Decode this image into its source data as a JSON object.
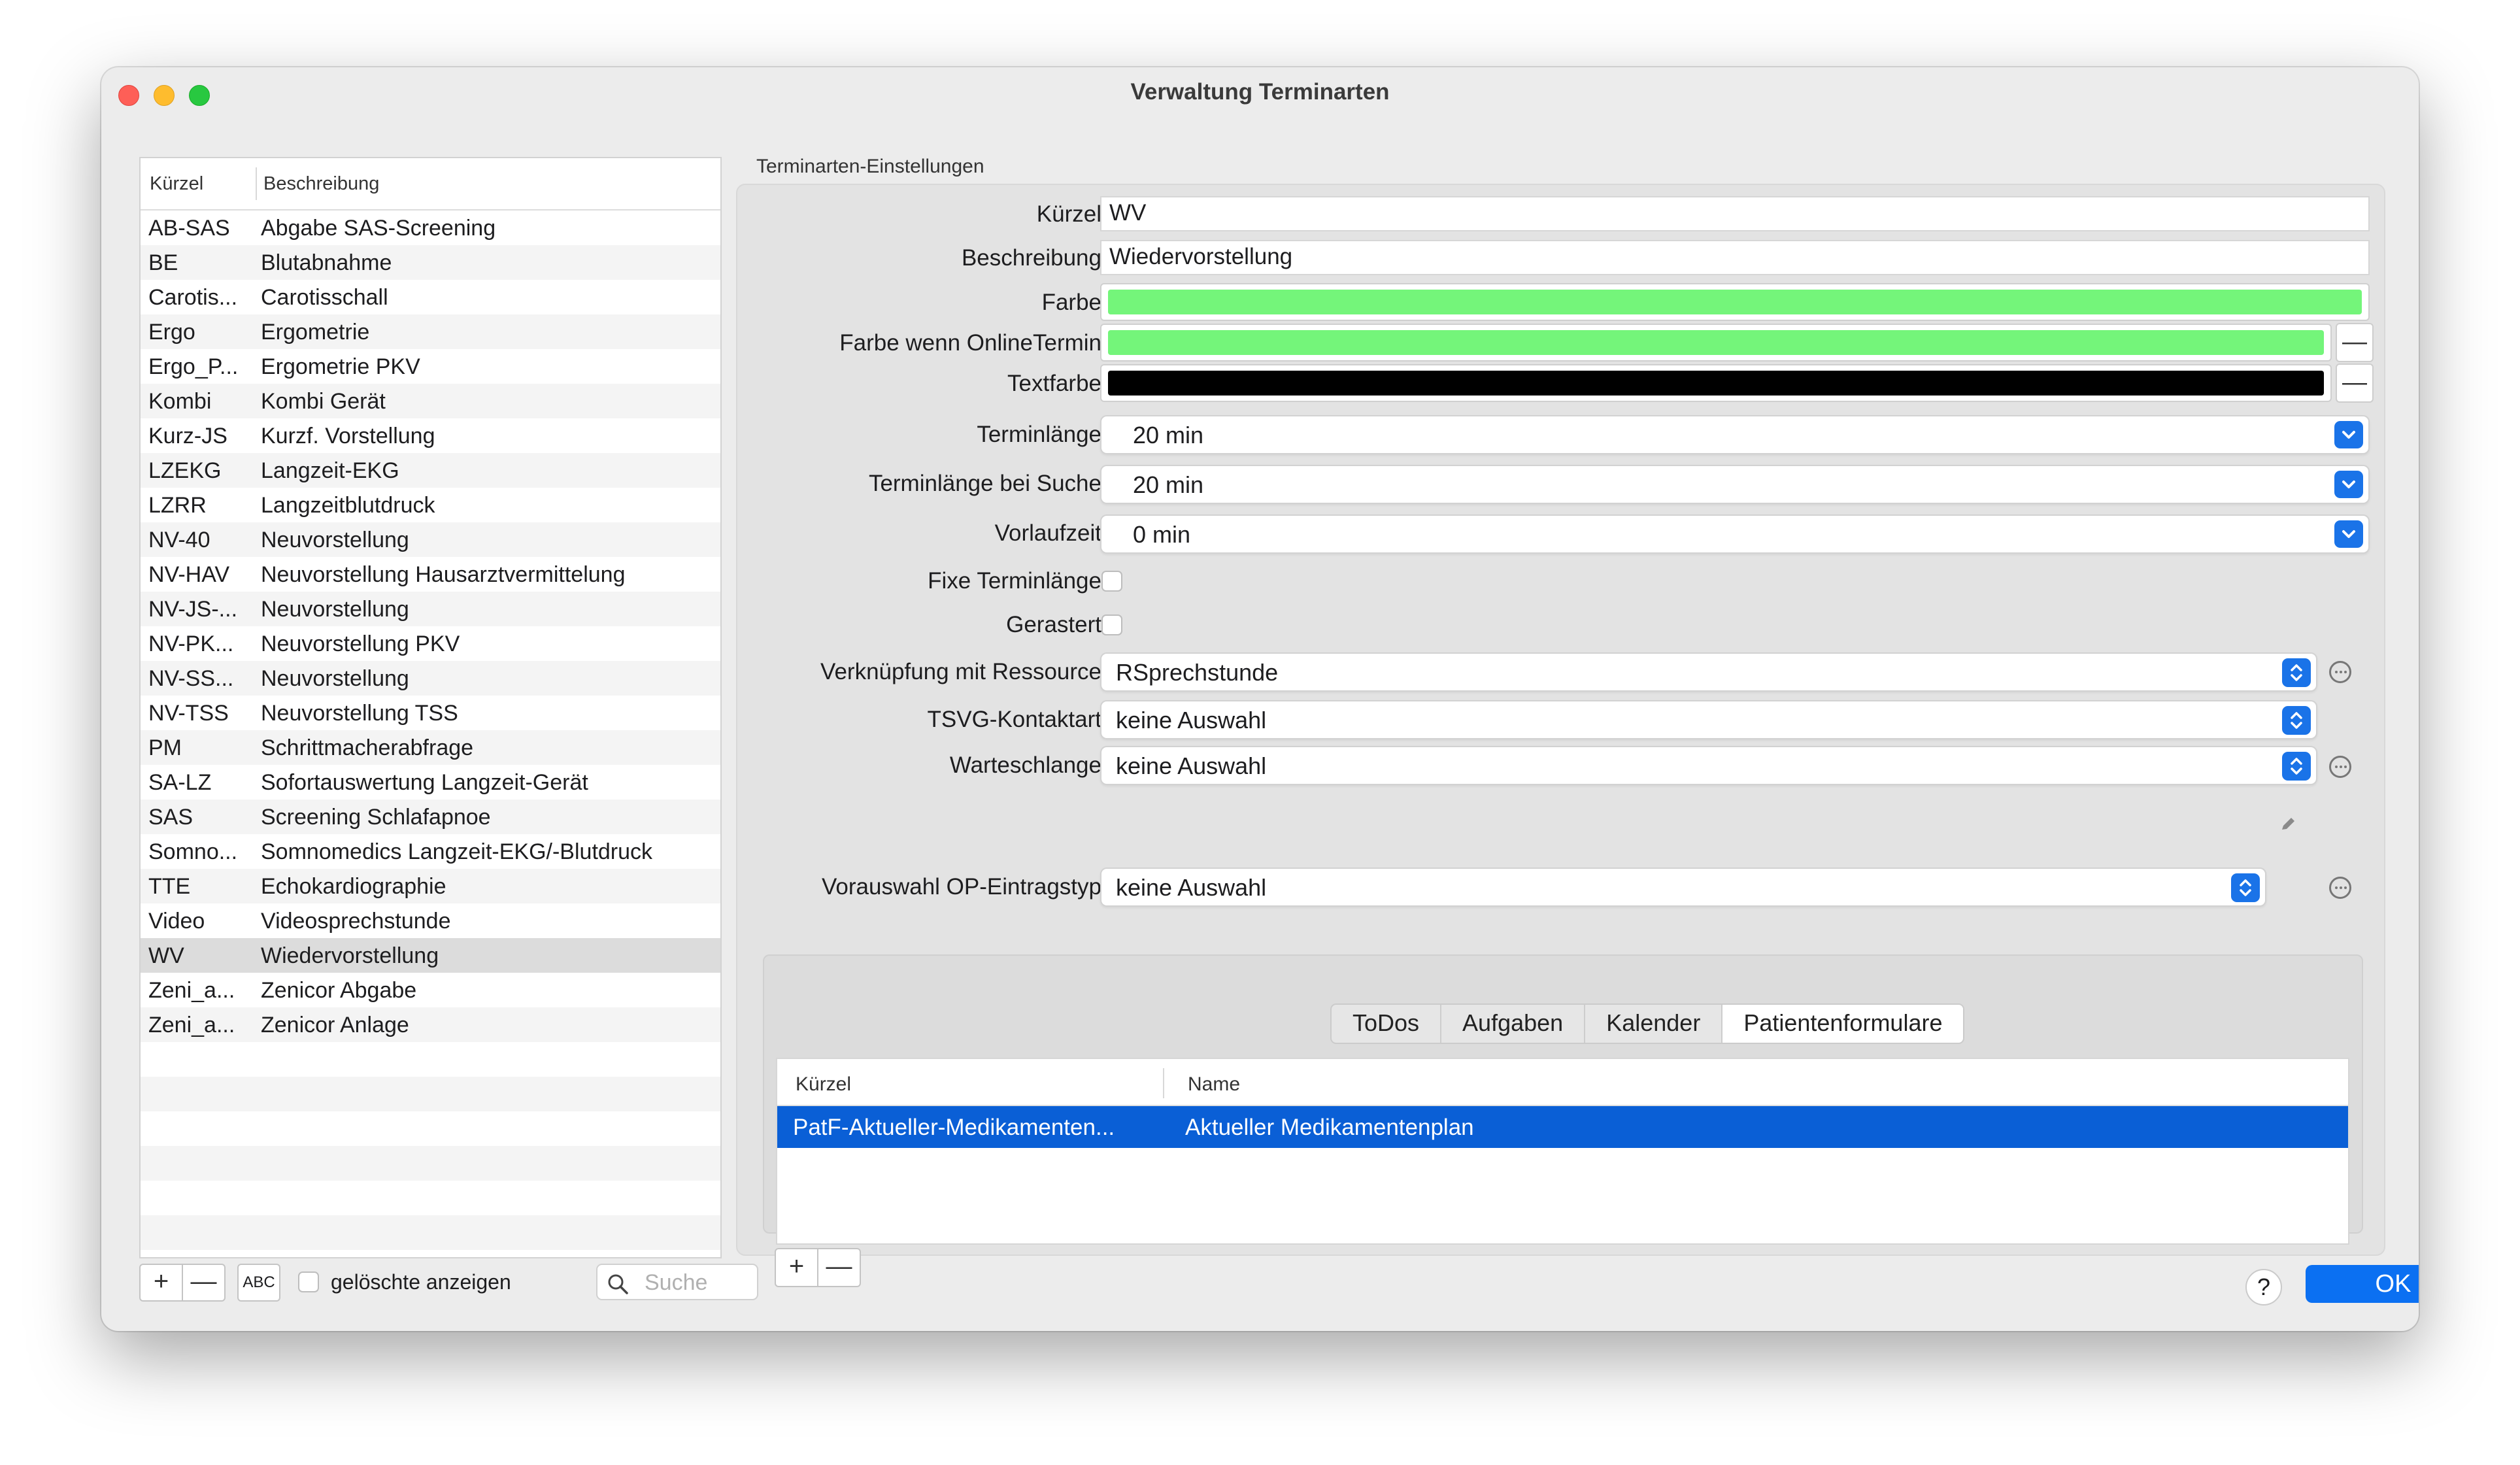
{
  "window": {
    "title": "Verwaltung Terminarten"
  },
  "list": {
    "headers": {
      "kuerzel": "Kürzel",
      "beschreibung": "Beschreibung"
    },
    "rows": [
      {
        "kuerzel": "AB-SAS",
        "beschreibung": "Abgabe SAS-Screening"
      },
      {
        "kuerzel": "BE",
        "beschreibung": "Blutabnahme"
      },
      {
        "kuerzel": "Carotis...",
        "beschreibung": "Carotisschall"
      },
      {
        "kuerzel": "Ergo",
        "beschreibung": "Ergometrie"
      },
      {
        "kuerzel": "Ergo_P...",
        "beschreibung": "Ergometrie PKV"
      },
      {
        "kuerzel": "Kombi",
        "beschreibung": "Kombi Gerät"
      },
      {
        "kuerzel": "Kurz-JS",
        "beschreibung": "Kurzf. Vorstellung"
      },
      {
        "kuerzel": "LZEKG",
        "beschreibung": "Langzeit-EKG"
      },
      {
        "kuerzel": "LZRR",
        "beschreibung": "Langzeitblutdruck"
      },
      {
        "kuerzel": "NV-40",
        "beschreibung": "Neuvorstellung"
      },
      {
        "kuerzel": "NV-HAV",
        "beschreibung": "Neuvorstellung Hausarztvermittelung"
      },
      {
        "kuerzel": "NV-JS-...",
        "beschreibung": "Neuvorstellung"
      },
      {
        "kuerzel": "NV-PK...",
        "beschreibung": "Neuvorstellung PKV"
      },
      {
        "kuerzel": "NV-SS...",
        "beschreibung": "Neuvorstellung"
      },
      {
        "kuerzel": "NV-TSS",
        "beschreibung": "Neuvorstellung TSS"
      },
      {
        "kuerzel": "PM",
        "beschreibung": "Schrittmacherabfrage"
      },
      {
        "kuerzel": "SA-LZ",
        "beschreibung": "Sofortauswertung Langzeit-Gerät"
      },
      {
        "kuerzel": "SAS",
        "beschreibung": "Screening Schlafapnoe"
      },
      {
        "kuerzel": "Somno...",
        "beschreibung": "Somnomedics Langzeit-EKG/-Blutdruck"
      },
      {
        "kuerzel": "TTE",
        "beschreibung": "Echokardiographie"
      },
      {
        "kuerzel": "Video",
        "beschreibung": "Videosprechstunde"
      },
      {
        "kuerzel": "WV",
        "beschreibung": "Wiedervorstellung"
      },
      {
        "kuerzel": "Zeni_a...",
        "beschreibung": "Zenicor Abgabe"
      },
      {
        "kuerzel": "Zeni_a...",
        "beschreibung": "Zenicor Anlage"
      }
    ],
    "selected_index": 21,
    "footer": {
      "add_label": "+",
      "remove_label": "—",
      "abc_label": "ABC",
      "show_deleted_label": "gelöschte anzeigen",
      "search_placeholder": "Suche"
    }
  },
  "settings": {
    "group_title": "Terminarten-Einstellungen",
    "kuerzel_label": "Kürzel",
    "kuerzel_value": "WV",
    "beschreibung_label": "Beschreibung",
    "beschreibung_value": "Wiedervorstellung",
    "farbe_label": "Farbe",
    "farbe_color": "#74f57a",
    "farbe_online_label": "Farbe wenn OnlineTermin",
    "farbe_online_color": "#74f57a",
    "textfarbe_label": "Textfarbe",
    "textfarbe_color": "#000000",
    "minus_label": "—",
    "terminlaenge_label": "Terminlänge",
    "terminlaenge_value": "20 min",
    "terminlaenge_suche_label": "Terminlänge bei Suche",
    "terminlaenge_suche_value": "20 min",
    "vorlaufzeit_label": "Vorlaufzeit",
    "vorlaufzeit_value": "0 min",
    "fixe_label": "Fixe Terminlänge",
    "gerastert_label": "Gerastert",
    "ressource_label": "Verknüpfung mit Ressource",
    "ressource_value": "RSprechstunde",
    "tsvg_label": "TSVG-Kontaktart",
    "tsvg_value": "keine Auswahl",
    "warteschlange_label": "Warteschlange",
    "warteschlange_value": "keine Auswahl",
    "op_label": "Vorauswahl OP-Eintragstyp",
    "op_value": "keine Auswahl",
    "accent_color": "#1a73e8"
  },
  "tabs": [
    {
      "label": "ToDos"
    },
    {
      "label": "Aufgaben"
    },
    {
      "label": "Kalender"
    },
    {
      "label": "Patientenformulare"
    }
  ],
  "active_tab": "Patientenformulare",
  "forms_table": {
    "headers": {
      "kuerzel": "Kürzel",
      "name": "Name"
    },
    "rows": [
      {
        "kuerzel": "PatF-Aktueller-Medikamenten...",
        "name": "Aktueller Medikamentenplan"
      }
    ],
    "add_label": "+",
    "remove_label": "—"
  },
  "buttons": {
    "help": "?",
    "ok": "OK"
  }
}
